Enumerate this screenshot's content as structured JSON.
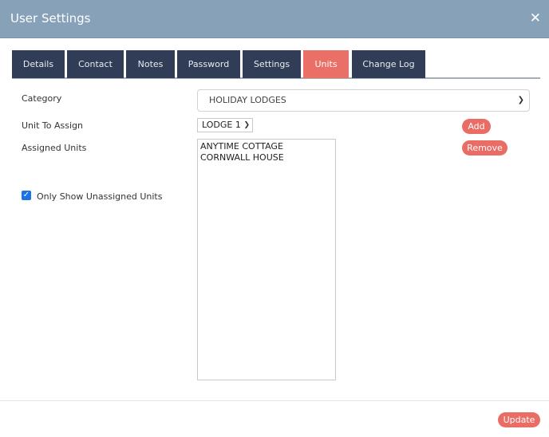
{
  "header": {
    "title": "User Settings",
    "close_icon": "close-icon"
  },
  "tabs": [
    {
      "label": "Details",
      "active": false
    },
    {
      "label": "Contact",
      "active": false
    },
    {
      "label": "Notes",
      "active": false
    },
    {
      "label": "Password",
      "active": false
    },
    {
      "label": "Settings",
      "active": false
    },
    {
      "label": "Units",
      "active": true
    },
    {
      "label": "Change Log",
      "active": false
    }
  ],
  "form": {
    "category_label": "Category",
    "category_value": "HOLIDAY LODGES",
    "unit_label": "Unit To Assign",
    "unit_value": "LODGE 1",
    "assigned_label": "Assigned Units",
    "assigned_units": [
      "ANYTIME COTTAGE",
      "CORNWALL HOUSE"
    ],
    "add_label": "Add",
    "remove_label": "Remove",
    "only_unassigned_label": "Only Show Unassigned Units",
    "only_unassigned_checked": true
  },
  "footer": {
    "update_label": "Update"
  },
  "colors": {
    "header": "#86a1b8",
    "tab": "#313d56",
    "accent": "#e96d65"
  }
}
